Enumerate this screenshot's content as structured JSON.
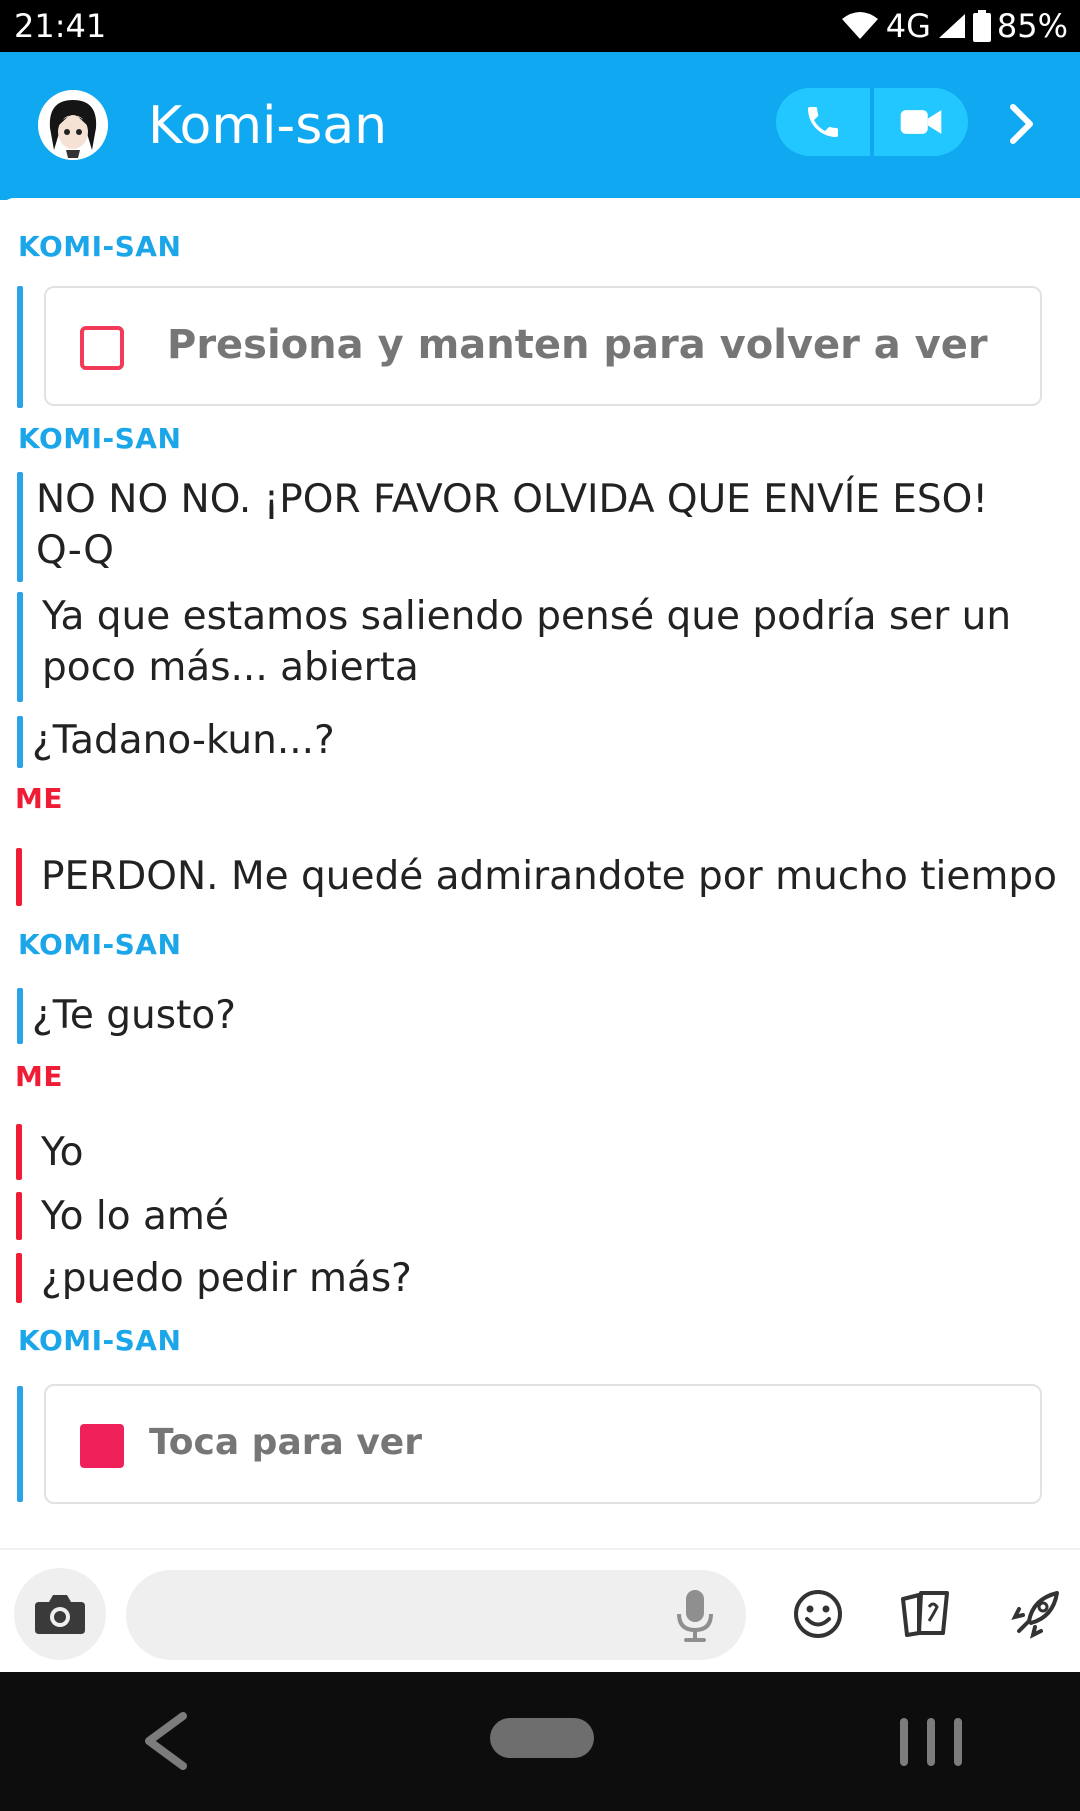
{
  "status_bar": {
    "time": "21:41",
    "network": "4G",
    "battery": "85%"
  },
  "header": {
    "contact_name": "Komi-san"
  },
  "messages": [
    {
      "type": "sender",
      "label": "KOMI-SAN",
      "who": "komi"
    },
    {
      "type": "snap",
      "text": "Presiona y manten para volver a ver"
    },
    {
      "type": "sender",
      "label": "KOMI-SAN",
      "who": "komi"
    },
    {
      "type": "text",
      "line1": "NO NO NO. ¡POR FAVOR OLVIDA QUE ENVÍE ESO!",
      "line2": "Q-Q"
    },
    {
      "type": "text",
      "line1": "Ya que estamos saliendo pensé que podría ser un",
      "line2": "poco más... abierta"
    },
    {
      "type": "text",
      "line1": "¿Tadano-kun...?"
    },
    {
      "type": "sender",
      "label": "ME",
      "who": "me"
    },
    {
      "type": "text",
      "line1": "PERDON. Me quedé admirandote por mucho tiempo"
    },
    {
      "type": "sender",
      "label": "KOMI-SAN",
      "who": "komi"
    },
    {
      "type": "text",
      "line1": "¿Te gusto?"
    },
    {
      "type": "sender",
      "label": "ME",
      "who": "me"
    },
    {
      "type": "text",
      "line1": "Yo"
    },
    {
      "type": "text",
      "line1": "Yo lo amé"
    },
    {
      "type": "text",
      "line1": "¿puedo pedir más?"
    },
    {
      "type": "sender",
      "label": "KOMI-SAN",
      "who": "komi"
    },
    {
      "type": "snap",
      "text": "Toca para ver"
    }
  ],
  "input": {
    "value": "",
    "placeholder": ""
  },
  "icons": {
    "call": "phone-icon",
    "video": "video-icon",
    "more": "chevron-right-icon",
    "camera": "camera-icon",
    "mic": "microphone-icon",
    "emoji": "smiley-icon",
    "stickers": "sticker-cards-icon",
    "games": "rocket-icon",
    "nav_back": "back-icon",
    "nav_home": "home-icon",
    "nav_recents": "recents-icon"
  },
  "colors": {
    "header": "#10a8f0",
    "komi": "#1aa6e8",
    "me": "#ee1d35",
    "snap_red": "#f0205a"
  }
}
